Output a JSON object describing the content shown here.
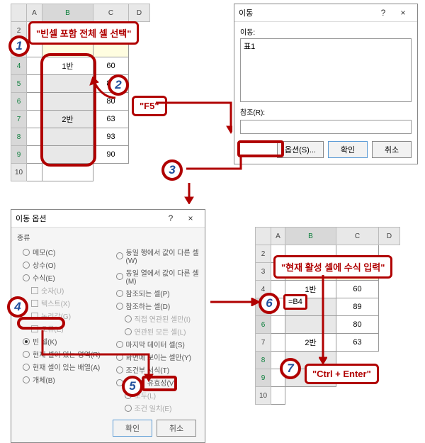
{
  "panel1": {
    "cols": [
      "A",
      "B",
      "C",
      "D"
    ],
    "rows": [
      "2",
      "3",
      "4",
      "5",
      "6",
      "7",
      "8",
      "9",
      "10"
    ],
    "data": {
      "B4": "1반",
      "C4": "60",
      "C5": "89",
      "C6": "80",
      "B7": "2반",
      "C7": "63",
      "C8": "93",
      "C9": "90"
    }
  },
  "gotoDialog": {
    "title": "이동",
    "help": "?",
    "close": "×",
    "listLabel": "이동:",
    "listItem": "표1",
    "refLabel": "참조(R):",
    "refValue": "",
    "optionsBtn": "옵션(S)...",
    "okBtn": "확인",
    "cancelBtn": "취소"
  },
  "specialDialog": {
    "title": "이동 옵션",
    "help": "?",
    "close": "×",
    "groupLabel": "종류",
    "left": [
      "메모(C)",
      "상수(O)",
      "수식(E)",
      "숫자(U)",
      "텍스트(X)",
      "논리값(G)",
      "오류(E)",
      "빈 셀(K)",
      "현재 셀이 있는 영역(R)",
      "현재 셀이 있는 배열(A)",
      "개체(B)"
    ],
    "right": [
      "동일 행에서 값이 다른 셀(W)",
      "동일 열에서 값이 다른 셀(M)",
      "참조되는 셀(P)",
      "참조하는 셀(D)",
      "직접 연관된 셀만(I)",
      "연관된 모든 셀(L)",
      "마지막 데이터 셀(S)",
      "화면에 보이는 셀만(Y)",
      "조건부 서식(T)",
      "데이터 유효성(V)",
      "모두(L)",
      "조건 일치(E)"
    ],
    "okBtn": "확인",
    "cancelBtn": "취소"
  },
  "panel4": {
    "cols": [
      "A",
      "B",
      "C",
      "D"
    ],
    "rows": [
      "2",
      "3",
      "4",
      "5",
      "6",
      "7",
      "8",
      "9",
      "10"
    ],
    "data": {
      "B4": "1반",
      "C4": "60",
      "C5": "89",
      "C6": "80",
      "B7": "2반",
      "C7": "63"
    }
  },
  "steps": {
    "s1": "1",
    "s2": "2",
    "s3": "3",
    "s4": "4",
    "s5": "5",
    "s6": "6",
    "s7": "7"
  },
  "callouts": {
    "c1": "\"빈셀 포함 전체 셀 선택\"",
    "c2": "\"F5\"",
    "c6": "\"현재 활성 셀에 수식 입력\"",
    "c7": "\"Ctrl + Enter\""
  },
  "formula": "=B4"
}
